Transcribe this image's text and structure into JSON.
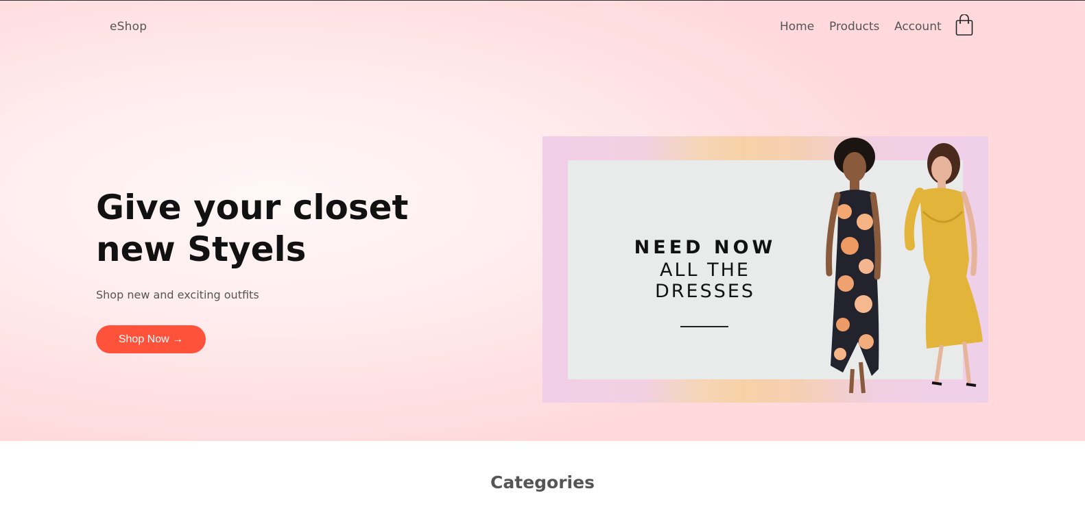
{
  "nav": {
    "logo": "eShop",
    "links": [
      "Home",
      "Products",
      "Account"
    ],
    "cart_icon": "shopping-bag-icon"
  },
  "hero": {
    "headline_line1": "Give your closet",
    "headline_line2": "new Styels",
    "subtext": "Shop new and exciting outfits",
    "cta_label": "Shop Now →",
    "cta_color": "#ff523b"
  },
  "banner": {
    "line1": "NEED NOW",
    "line2": "ALL THE DRESSES"
  },
  "sections": {
    "categories_title": "Categories"
  }
}
